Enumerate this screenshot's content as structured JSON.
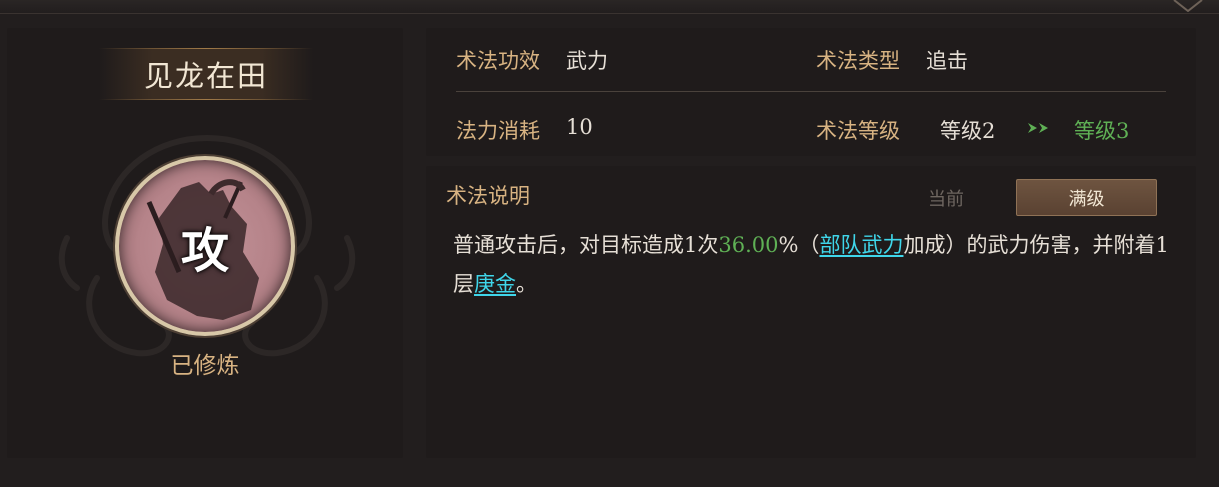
{
  "skill": {
    "name": "见龙在田",
    "icon_char": "攻",
    "status": "已修炼"
  },
  "info": {
    "effect_label": "术法功效",
    "effect_value": "武力",
    "type_label": "术法类型",
    "type_value": "追击",
    "cost_label": "法力消耗",
    "cost_value": "10",
    "level_label": "术法等级",
    "level_current": "等级2",
    "level_next": "等级3"
  },
  "description": {
    "title": "术法说明",
    "tabs": {
      "current": "当前",
      "max": "满级",
      "selected": "满级"
    },
    "parts": {
      "p1": "普通攻击后，对目标造成1次",
      "percent": "36.00",
      "p2": "%（",
      "link1": "部队武力",
      "p3": "加成）的武力伤害，并附着1层",
      "link2": "庚金",
      "p4": "。"
    }
  },
  "icons": [
    "arrow-right-double-icon",
    "skill-figure-icon",
    "ornament-icon",
    "corner-notch-icon"
  ],
  "colors": {
    "label_gold": "#d8b382",
    "value_light": "#e6dfd6",
    "upgrade_green": "#5fb055",
    "link_cyan": "#3fd6ea",
    "panel_bg": "#1f1b1b"
  }
}
